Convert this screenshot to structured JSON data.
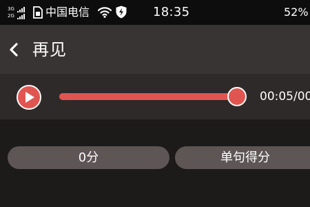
{
  "status_bar": {
    "network_top": "3G",
    "network_bottom": "2G",
    "carrier": "中国电信",
    "time": "18:35",
    "battery_percent": "52%"
  },
  "header": {
    "title": "再见"
  },
  "player": {
    "progress_fraction": 1.0,
    "time_display": "00:05/00"
  },
  "scores": {
    "total_score": "0分",
    "sentence_score": "单句得分"
  },
  "colors": {
    "accent": "#e05550",
    "header_bg": "#383433",
    "player_bg": "#2e2a29",
    "pill_bg": "#5e5655",
    "page_bg": "#1d1b1a"
  },
  "icons": {
    "back": "chevron-left-icon",
    "play": "play-icon",
    "wifi": "wifi-icon",
    "sim": "sim-card-icon",
    "shield": "shield-bolt-icon"
  }
}
